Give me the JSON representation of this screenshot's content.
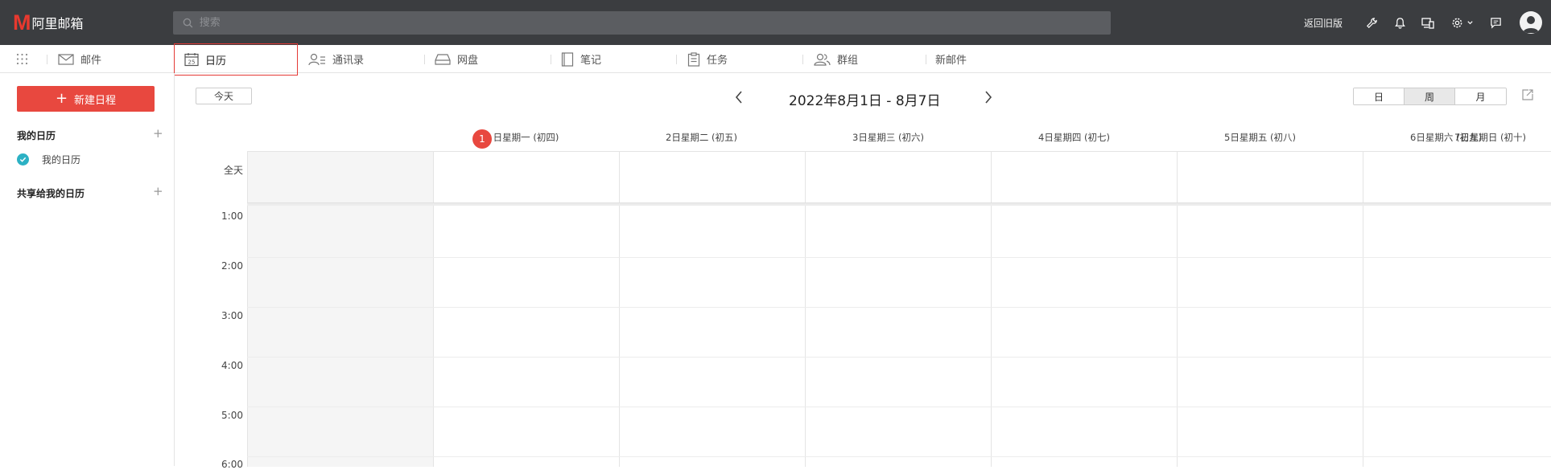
{
  "app": {
    "logo_letter": "M",
    "logo_text": "阿里邮箱"
  },
  "search": {
    "placeholder": "搜索"
  },
  "topbar": {
    "old_version": "返回旧版"
  },
  "nav": {
    "items": [
      {
        "label": "邮件",
        "icon": "mail-icon"
      },
      {
        "label": "日历",
        "icon": "calendar-icon",
        "calendar_day": "25"
      },
      {
        "label": "通讯录",
        "icon": "contacts-icon"
      },
      {
        "label": "网盘",
        "icon": "drive-icon"
      },
      {
        "label": "笔记",
        "icon": "notes-icon"
      },
      {
        "label": "任务",
        "icon": "tasks-icon"
      },
      {
        "label": "群组",
        "icon": "groups-icon"
      },
      {
        "label": "新邮件"
      }
    ]
  },
  "sidebar": {
    "new_event": "新建日程",
    "my_calendars_title": "我的日历",
    "my_calendar_item": "我的日历",
    "shared_title": "共享给我的日历"
  },
  "calendar": {
    "today_button": "今天",
    "range_title": "2022年8月1日 - 8月7日",
    "views": [
      "日",
      "周",
      "月"
    ],
    "active_view": "周",
    "today_day_number": "1",
    "days": [
      "日星期一 (初四)",
      "2日星期二 (初五)",
      "3日星期三 (初六)",
      "4日星期四 (初七)",
      "5日星期五 (初八)",
      "6日星期六 (初九)",
      "7日星期日 (初十)"
    ],
    "all_day_label": "全天",
    "hours": [
      "1:00",
      "2:00",
      "3:00",
      "4:00",
      "5:00",
      "6:00"
    ]
  },
  "colors": {
    "accent": "#e8483f",
    "topbar": "#3b3d40",
    "check": "#2cb1c4"
  }
}
